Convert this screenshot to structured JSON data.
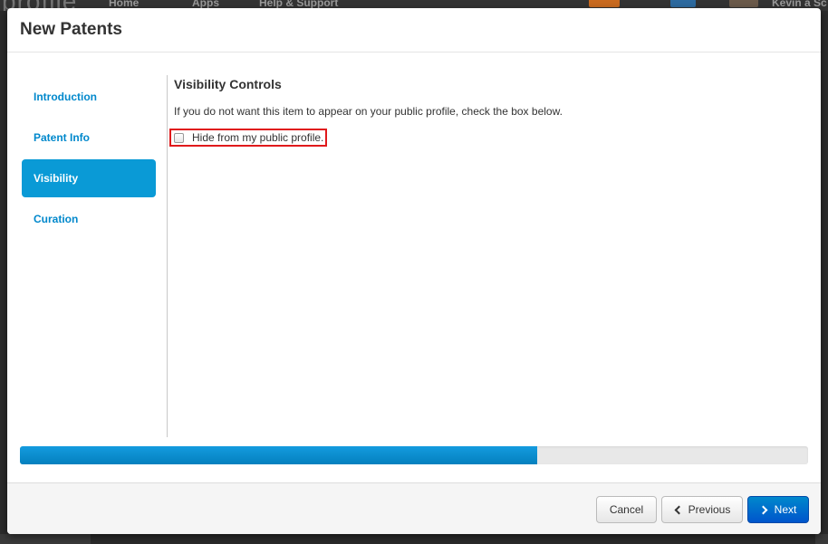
{
  "background_nav": {
    "logo": "profile",
    "items": [
      "Home",
      "Apps",
      "Help & Support"
    ],
    "user": "Kevin a Sc"
  },
  "modal": {
    "title": "New Patents",
    "sidebar": {
      "items": [
        {
          "label": "Introduction",
          "active": false
        },
        {
          "label": "Patent Info",
          "active": false
        },
        {
          "label": "Visibility",
          "active": true
        },
        {
          "label": "Curation",
          "active": false
        }
      ]
    },
    "section": {
      "heading": "Visibility Controls",
      "help_text": "If you do not want this item to appear on your public profile, check the box below.",
      "checkbox_label": "Hide from my public profile.",
      "checkbox_checked": false
    },
    "progress_fraction": 0.656,
    "footer": {
      "cancel_label": "Cancel",
      "previous_label": "Previous",
      "next_label": "Next"
    }
  },
  "colors": {
    "accent": "#0a9ad6",
    "link": "#0088cc",
    "primary_button": "#0066cc",
    "highlight_border": "#e0191b"
  },
  "icons": {
    "previous": "chevron-left-icon",
    "next": "chevron-right-icon"
  }
}
